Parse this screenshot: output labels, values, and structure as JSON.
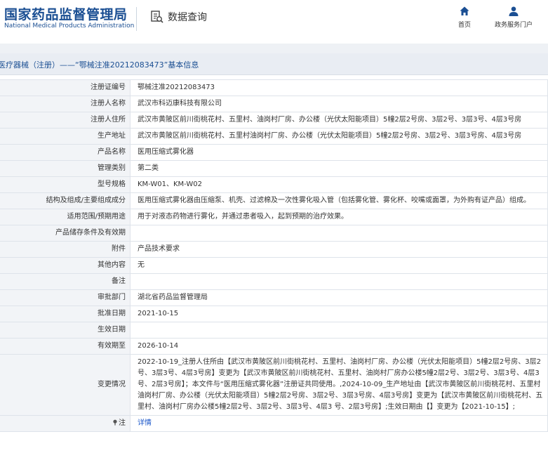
{
  "header": {
    "logo_cn": "国家药品监督管理局",
    "logo_en": "National Medical Products Administration",
    "query_label": "数据查询",
    "nav": [
      {
        "label": "首页",
        "icon": "home-icon"
      },
      {
        "label": "政务服务门户",
        "icon": "user-icon"
      }
    ]
  },
  "colors": {
    "brand": "#1b4f93",
    "link": "#1a56c9",
    "label_bg": "#f2f4f7",
    "border": "#dee3ea"
  },
  "title": "医疗器械（注册）——“鄂械注准20212083473”基本信息",
  "rows": [
    {
      "label": "注册证编号",
      "value": "鄂械注准20212083473"
    },
    {
      "label": "注册人名称",
      "value": "武汉市科迈康科技有限公司"
    },
    {
      "label": "注册人住所",
      "value": "武汉市黄陂区前川街桃花村、五里村、油岗村厂房、办公楼（光伏太阳能项目）5幢2层2号房、3层2号、3层3号、4层3号房"
    },
    {
      "label": "生产地址",
      "value": "武汉市黄陂区前川街桃花村、五里村油岗村厂房、办公楼（光伏太阳能项目）5幢2层2号房、3层2号、3层3号房、4层3号房"
    },
    {
      "label": "产品名称",
      "value": "医用压缩式雾化器"
    },
    {
      "label": "管理类别",
      "value": "第二类"
    },
    {
      "label": "型号规格",
      "value": "KM-W01、KM-W02"
    },
    {
      "label": "结构及组成/主要组成成分",
      "value": "医用压缩式雾化器由压缩泵、机壳、过滤棉及一次性雾化吸入管（包括雾化管、雾化杯、咬嘴或面罩，为外购有证产品）组成。"
    },
    {
      "label": "适用范围/预期用途",
      "value": "用于对液态药物进行雾化，并通过患者吸入，起到预期的治疗效果。"
    },
    {
      "label": "产品储存条件及有效期",
      "value": ""
    },
    {
      "label": "附件",
      "value": "产品技术要求"
    },
    {
      "label": "其他内容",
      "value": "无"
    },
    {
      "label": "备注",
      "value": ""
    },
    {
      "label": "审批部门",
      "value": "湖北省药品监督管理局"
    },
    {
      "label": "批准日期",
      "value": "2021-10-15"
    },
    {
      "label": "生效日期",
      "value": ""
    },
    {
      "label": "有效期至",
      "value": "2026-10-14"
    },
    {
      "label": "变更情况",
      "value": "2022-10-19_注册人住所由【武汉市黄陂区前川街桃花村、五里村、油岗村厂房、办公楼（光伏太阳能项目）5幢2层2号房、3层2号、3层3号、4层3号房】变更为【武汉市黄陂区前川街桃花村、五里村、油岗村厂房办公楼5幢2层2号、3层2号、3层3号、4层3号、2层3号房】；本文件与“医用压缩式雾化器”注册证共同使用。,2024-10-09_生产地址由【武汉市黄陂区前川街桃花村、五里村油岗村厂房、办公楼（光伏太阳能项目）5幢2层2号房、3层2号、3层3号房、4层3号房】变更为【武汉市黄陂区前川街桃花村、五里村、油岗村厂房办公楼5幢2层2号、3层2号、3层3号、4层3 号、2层3号房】;生效日期由【】变更为【2021-10-15】;"
    },
    {
      "label": "注",
      "value": "详情",
      "label_icon": "pin-icon"
    }
  ]
}
